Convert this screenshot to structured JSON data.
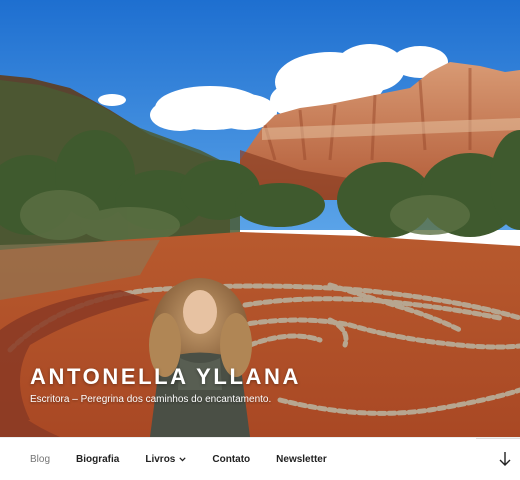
{
  "site": {
    "title": "ANTONELLA YLLANA",
    "tagline": "Escritora – Peregrina dos caminhos do encantamento."
  },
  "nav": {
    "items": [
      {
        "label": "Blog",
        "current": true
      },
      {
        "label": "Biografia",
        "current": false
      },
      {
        "label": "Livros",
        "current": false,
        "has_submenu": true
      },
      {
        "label": "Contato",
        "current": false
      },
      {
        "label": "Newsletter",
        "current": false
      }
    ],
    "scroll_icon": "arrow-down-icon",
    "submenu_icon": "chevron-down-icon"
  },
  "hero": {
    "image": "desert-labyrinth-photo",
    "colors": {
      "sky": "#2f7fd6",
      "earth": "#b8512a",
      "rock": "#c4754e"
    }
  }
}
